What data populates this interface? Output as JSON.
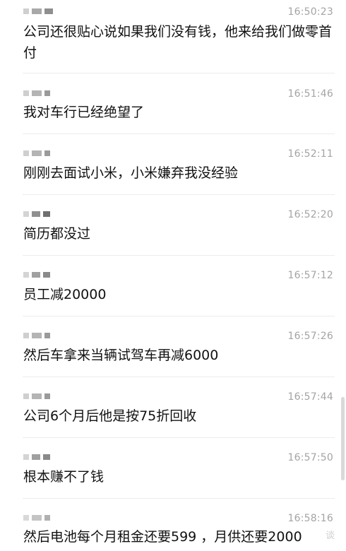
{
  "messages": [
    {
      "time": "16:50:23",
      "text": "公司还很贴心说如果我们没有钱，他来给我们做零首付"
    },
    {
      "time": "16:51:46",
      "text": "我对车行已经绝望了"
    },
    {
      "time": "16:52:11",
      "text": "刚刚去面试小米，小米嫌弃我没经验"
    },
    {
      "time": "16:52:20",
      "text": "简历都没过"
    },
    {
      "time": "16:57:12",
      "text": "员工减20000"
    },
    {
      "time": "16:57:26",
      "text": "然后车拿来当辆试驾车再减6000"
    },
    {
      "time": "16:57:44",
      "text": "公司6个月后他是按75折回收"
    },
    {
      "time": "16:57:50",
      "text": "根本赚不了钱"
    },
    {
      "time": "16:58:16",
      "text": "然后电池每个月租金还要599 ，月供还要2000"
    }
  ],
  "watermark": "谈",
  "colors": {
    "text": "#111111",
    "timestamp": "#a4a4a4",
    "divider": "#ececec",
    "background": "#ffffff"
  },
  "icons": {
    "sender_avatar": "pixelated-name-icon"
  }
}
